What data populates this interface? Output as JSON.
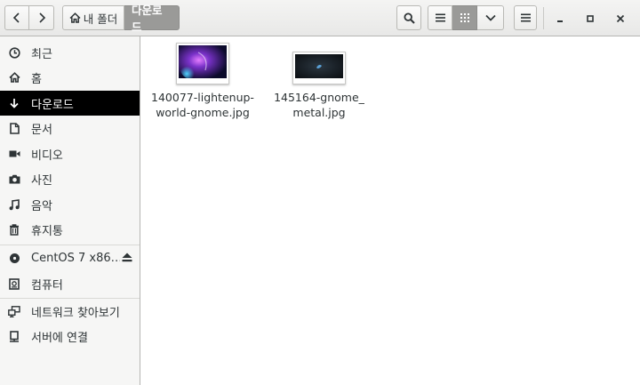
{
  "path_bar": {
    "home_label": "내 폴더",
    "current_label": "다운로드"
  },
  "sidebar": {
    "items": [
      {
        "label": "최근",
        "icon": "clock-icon"
      },
      {
        "label": "홈",
        "icon": "home-icon"
      },
      {
        "label": "다운로드",
        "icon": "download-icon",
        "selected": true
      },
      {
        "label": "문서",
        "icon": "document-icon"
      },
      {
        "label": "비디오",
        "icon": "video-icon"
      },
      {
        "label": "사진",
        "icon": "camera-icon"
      },
      {
        "label": "음악",
        "icon": "music-icon"
      },
      {
        "label": "휴지통",
        "icon": "trash-icon"
      }
    ],
    "devices": [
      {
        "label": "CentOS 7 x86…",
        "icon": "disc-icon",
        "eject": true
      },
      {
        "label": "컴퓨터",
        "icon": "computer-icon"
      }
    ],
    "network": [
      {
        "label": "네트워크 찾아보기",
        "icon": "network-icon"
      },
      {
        "label": "서버에 연결",
        "icon": "server-icon"
      }
    ]
  },
  "files": [
    {
      "name": "140077-lightenup-world-gnome.jpg",
      "name_line1": "140077-lightenup-",
      "name_line2": "world-gnome.jpg"
    },
    {
      "name": "145164-gnome_metal.jpg",
      "name_line1": "145164-gnome_",
      "name_line2": "metal.jpg"
    }
  ],
  "colors": {
    "selected_bg": "#000000",
    "active_toggle": "#9a9a98"
  }
}
